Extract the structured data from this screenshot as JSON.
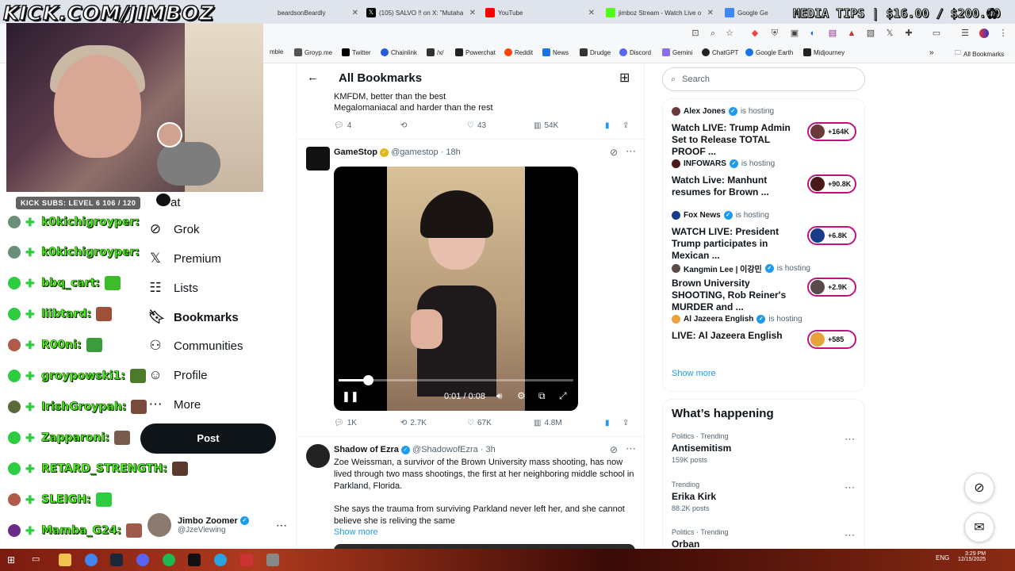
{
  "tabs": [
    {
      "title": "beardsonBeardly",
      "color": "#888"
    },
    {
      "title": "(105) SALVO !! on X: \"Mutaha",
      "color": "#000"
    },
    {
      "title": "YouTube",
      "color": "#ff0000"
    },
    {
      "title": "jimboz Stream - Watch Live o",
      "color": "#53fc18"
    },
    {
      "title": "Google Ge",
      "color": "#4285f4"
    }
  ],
  "bookmarks": [
    {
      "label": "mble",
      "color": "#666"
    },
    {
      "label": "Groyp.me",
      "color": "#555"
    },
    {
      "label": "Twitter",
      "color": "#000"
    },
    {
      "label": "Chainlink",
      "color": "#2a5ada"
    },
    {
      "label": "/x/",
      "color": "#333"
    },
    {
      "label": "Powerchat",
      "color": "#222"
    },
    {
      "label": "Reddit",
      "color": "#ff4500"
    },
    {
      "label": "News",
      "color": "#1a73e8"
    },
    {
      "label": "Drudge",
      "color": "#333"
    },
    {
      "label": "Discord",
      "color": "#5865f2"
    },
    {
      "label": "Gemini",
      "color": "#8e6ef0"
    },
    {
      "label": "ChatGPT",
      "color": "#222"
    },
    {
      "label": "Google Earth",
      "color": "#1a73e8"
    },
    {
      "label": "Midjourney",
      "color": "#222"
    }
  ],
  "all_bookmarks_label": "All Bookmarks",
  "overlay": {
    "channel": "KICK.COM/JIMBOZ",
    "media_tips": "MEDIA TIPS | $16.00 / $200.00",
    "subs": "KICK SUBS: LEVEL 6 106 / 120"
  },
  "chat": [
    {
      "name": "k0kichigroyper:",
      "av": "#6a8f7a",
      "emote": ""
    },
    {
      "name": "k0kichigroyper:",
      "av": "#6a8f7a",
      "emote": ""
    },
    {
      "name": "bbq_cart:",
      "av": "#2ecc40",
      "emote": "#3cbc2c"
    },
    {
      "name": "liibtard:",
      "av": "#2ecc40",
      "emote": "#a0503a"
    },
    {
      "name": "R00ni:",
      "av": "#b05a4a",
      "emote": "#3a9c3a"
    },
    {
      "name": "groypowski1:",
      "av": "#2ecc40",
      "emote": "#4a7a2a"
    },
    {
      "name": "IrishGroypah:",
      "av": "#5a6a3a",
      "emote": "#7a4a3a"
    },
    {
      "name": "Zapparoni:",
      "av": "#2ecc40",
      "emote": "#7a5a4a"
    },
    {
      "name": "RETARD_STRENGTH:",
      "av": "#2ecc40",
      "emote": "#5a3a2a"
    },
    {
      "name": "SLEIGH:",
      "av": "#b05a4a",
      "emote": "#2ecc40"
    },
    {
      "name": "Mamba_G24:",
      "av": "#6a2a8a",
      "emote": "#a05a4a"
    }
  ],
  "nav": {
    "chat_partial": "at",
    "items": [
      "Grok",
      "Premium",
      "Lists",
      "Bookmarks",
      "Communities",
      "Profile",
      "More"
    ],
    "post": "Post",
    "account_name": "Jimbo Zoomer",
    "account_handle": "@JzeViewing"
  },
  "feed": {
    "header": "All Bookmarks",
    "prev_tweet": {
      "line1": "KMFDM, better than the best",
      "line2": "Megalomaniacal and harder than the rest",
      "replies": "4",
      "retweets": "",
      "likes": "43",
      "views": "54K"
    },
    "tweet1": {
      "name": "GameStop",
      "handle": "@gamestop",
      "time": "18h",
      "video_time": "0:01 / 0:08",
      "progress": 0.125,
      "replies": "1K",
      "retweets": "2.7K",
      "likes": "67K",
      "views": "4.8M"
    },
    "tweet2": {
      "name": "Shadow of Ezra",
      "handle": "@ShadowofEzra",
      "time": "3h",
      "text1": "Zoe Weissman, a survivor of the Brown University mass shooting, has now lived through two mass shootings, the first at her neighboring middle school in Parkland, Florida.",
      "text2": "She says the trauma from surviving Parkland never left her, and she cannot believe she is reliving the same",
      "show_more": "Show more"
    }
  },
  "search_placeholder": "Search",
  "live": [
    {
      "host": "Alex Jones",
      "title": "Watch LIVE: Trump Admin Set to Release TOTAL PROOF ...",
      "count": "+164K",
      "av": "#6a3a3a"
    },
    {
      "host": "INFOWARS",
      "title": "Watch Live: Manhunt resumes for Brown ...",
      "count": "+90.8K",
      "av": "#4a1a1a"
    },
    {
      "host": "Fox News",
      "title": "WATCH LIVE: President Trump participates in Mexican ...",
      "count": "+6.8K",
      "av": "#1a3a8a"
    },
    {
      "host": "Kangmin Lee | 이강민",
      "title": "Brown University SHOOTING, Rob Reiner's MURDER and ...",
      "count": "+2.9K",
      "av": "#5a4a4a"
    },
    {
      "host": "Al Jazeera English",
      "title": "LIVE: Al Jazeera English",
      "count": "+585",
      "av": "#e8a33a"
    }
  ],
  "is_hosting": "is hosting",
  "show_more": "Show more",
  "trends_title": "What’s happening",
  "trends": [
    {
      "cat": "Politics · Trending",
      "name": "Antisemitism",
      "count": "159K posts"
    },
    {
      "cat": "Trending",
      "name": "Erika Kirk",
      "count": "88.2K posts"
    },
    {
      "cat": "Politics · Trending",
      "name": "Orban",
      "count": ""
    }
  ],
  "taskbar": {
    "lang": "ENG",
    "time": "3:29 PM",
    "date": "12/15/2025"
  }
}
